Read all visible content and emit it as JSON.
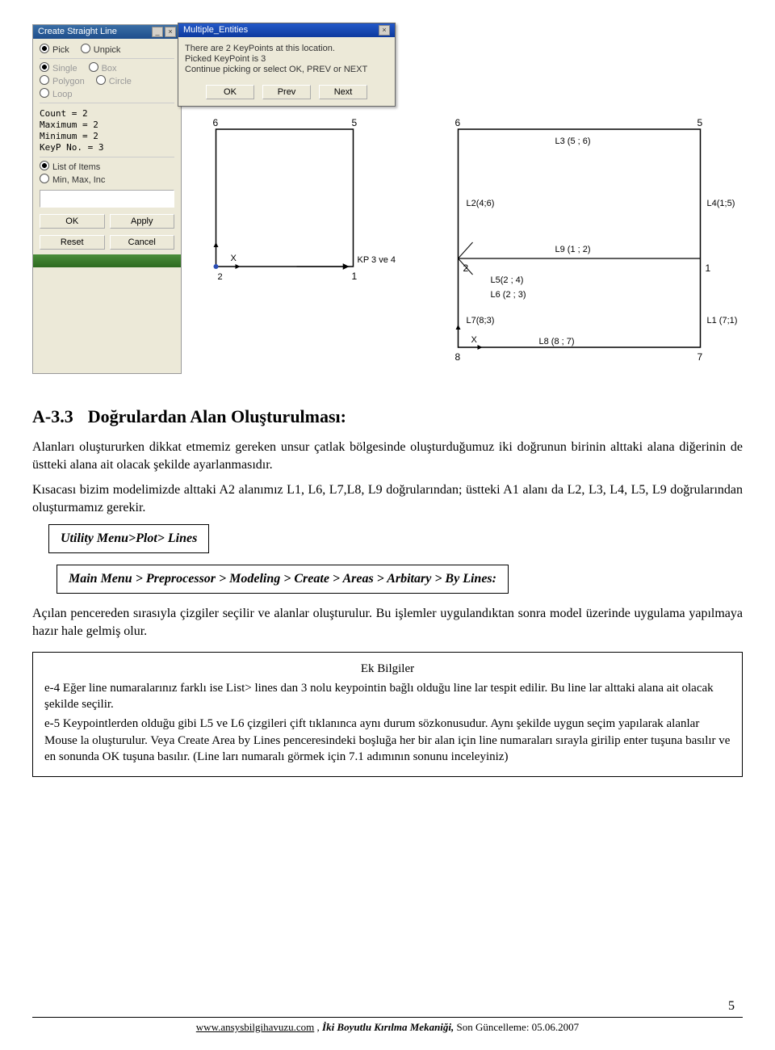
{
  "dialog": {
    "title": "Create Straight Line",
    "pick": "Pick",
    "unpick": "Unpick",
    "single": "Single",
    "box": "Box",
    "polygon": "Polygon",
    "circle": "Circle",
    "loop": "Loop",
    "count": "Count    =  2",
    "maximum": "Maximum  =  2",
    "minimum": "Minimum  =  2",
    "keyp": "KeyP No. =  3",
    "listItems": "List of Items",
    "minMaxInc": "Min, Max, Inc",
    "ok": "OK",
    "apply": "Apply",
    "reset": "Reset",
    "cancel": "Cancel"
  },
  "popup": {
    "title": "Multiple_Entities",
    "line1": "There are  2 KeyPoints at this location.",
    "line2": "Picked KeyPoint is 3",
    "line3": "Continue picking or select  OK, PREV or NEXT",
    "ok": "OK",
    "prev": "Prev",
    "next": "Next"
  },
  "diagramLeft": {
    "p6": "6",
    "p5": "5",
    "p1": "1",
    "p2": "2",
    "kp34": "KP 3 ve 4",
    "x": "X"
  },
  "diagramRight": {
    "p6": "6",
    "p5": "5",
    "p2": "2",
    "p1": "1",
    "p8": "8",
    "p7": "7",
    "l3": "L3 (5 ; 6)",
    "l2": "L2(4;6)",
    "l4": "L4(1;5)",
    "l9": "L9 (1 ; 2)",
    "l5": "L5(2 ; 4)",
    "l6": "L6 (2 ; 3)",
    "l7": "L7(8;3)",
    "l1": "L1 (7;1)",
    "l8": "L8 (8 ; 7)",
    "x": "X"
  },
  "section": {
    "num": "A-3.3",
    "title": "Doğrulardan Alan Oluşturulması:"
  },
  "para1": "Alanları oluştururken dikkat etmemiz gereken unsur çatlak bölgesinde oluşturduğumuz iki doğrunun birinin alttaki alana diğerinin de üstteki alana ait olacak şekilde ayarlanmasıdır.",
  "para2": "Kısacası bizim modelimizde alttaki A2 alanımız L1, L6, L7,L8, L9 doğrularından;  üstteki A1 alanı da  L2, L3, L4, L5, L9 doğrularından oluşturmamız gerekir.",
  "cmd1": "Utility Menu>Plot> Lines",
  "cmd2": "Main Menu > Preprocessor  > Modeling > Create > Areas > Arbitary > By Lines:",
  "para3": "Açılan pencereden sırasıyla çizgiler seçilir ve alanlar oluşturulur. Bu işlemler uygulandıktan sonra model üzerinde uygulama yapılmaya hazır hale gelmiş olur.",
  "ek": {
    "header": "Ek Bilgiler",
    "e4a": "e-4 Eğer line numaralarınız farklı ise List> lines dan 3 nolu keypointin bağlı olduğu line lar tespit edilir. Bu line lar alttaki alana ait olacak şekilde seçilir.",
    "e5a": "e-5 Keypointlerden olduğu gibi L5 ve L6 çizgileri çift tıklanınca aynı durum sözkonusudur. Aynı şekilde uygun seçim yapılarak alanlar Mouse la oluşturulur. Veya Create Area by Lines penceresindeki boşluğa her bir alan için line numaraları sırayla girilip enter tuşuna basılır ve en sonunda OK tuşuna basılır. (Line ları numaralı görmek için 7.1 adımının sonunu inceleyiniz)"
  },
  "footer": {
    "site": "www.ansysbilgihavuzu.com",
    "sep": " ,   ",
    "title": "İki Boyutlu Kırılma Mekaniği, ",
    "update": "Son Güncelleme: 05.06.2007"
  },
  "pageNum": "5"
}
